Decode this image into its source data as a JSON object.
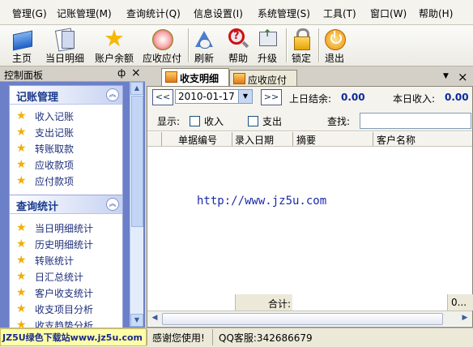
{
  "menu": [
    "管理(G)",
    "记账管理(M)",
    "查询统计(Q)",
    "信息设置(I)",
    "系统管理(S)",
    "工具(T)",
    "窗口(W)",
    "帮助(H)"
  ],
  "toolbar": [
    "主页",
    "当日明细",
    "账户余额",
    "应收应付",
    "刷新",
    "帮助",
    "升级",
    "锁定",
    "退出"
  ],
  "left_panel": {
    "title": "控制面板",
    "pin": "ф",
    "close": "×",
    "groups": [
      {
        "title": "记账管理",
        "items": [
          "收入记账",
          "支出记账",
          "转账取款",
          "应收款项",
          "应付款项"
        ]
      },
      {
        "title": "查询统计",
        "items": [
          "当日明细统计",
          "历史明细统计",
          "转账统计",
          "日汇总统计",
          "客户收支统计",
          "收支项目分析",
          "收支趋势分析"
        ]
      }
    ]
  },
  "tabs": [
    "收支明细",
    "应收应付"
  ],
  "tab_controls": {
    "dropdown": "▼",
    "close": "×"
  },
  "datebar": {
    "prev": "<<",
    "date": "2010-01-17",
    "next": ">>",
    "prev_balance_label": "上日结余:",
    "prev_balance_value": "0.00",
    "income_label": "本日收入:",
    "income_value": "0.00"
  },
  "filter": {
    "show_label": "显示:",
    "income": "收入",
    "expense": "支出",
    "search_label": "查找:"
  },
  "columns": [
    "单据编号",
    "录入日期",
    "摘要",
    "客户名称"
  ],
  "watermark": "http://www.jz5u.com",
  "footer": {
    "total_label": "合计:",
    "amount": "0..."
  },
  "status": {
    "badge": "JZ5U绿色下载站www.jz5u.com",
    "thanks": "感谢您使用!",
    "qq": "QQ客服:342686679"
  }
}
